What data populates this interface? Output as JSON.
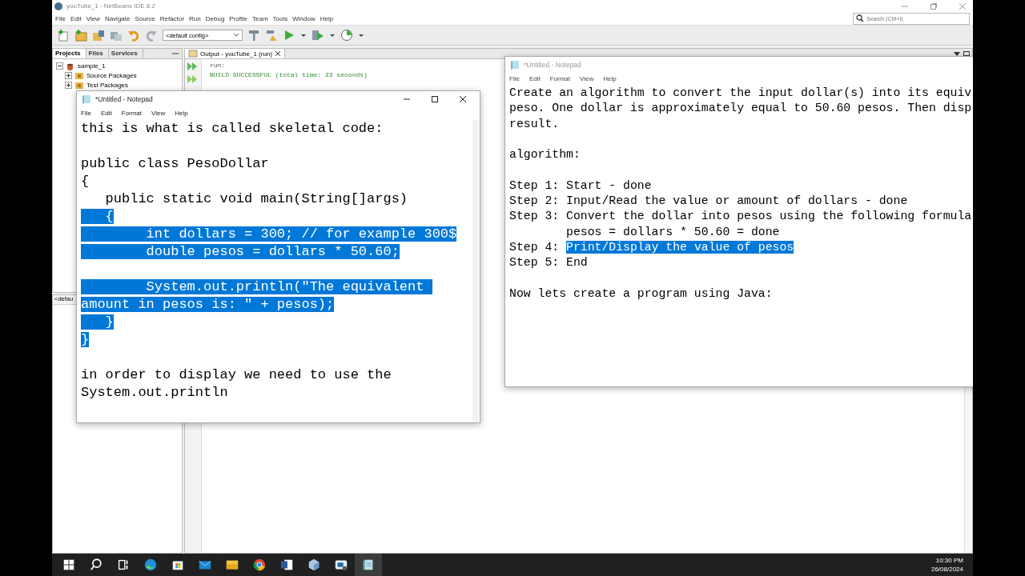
{
  "ide": {
    "title": "youTube_1 - NetBeans IDE 8.2",
    "menu": [
      "File",
      "Edit",
      "View",
      "Navigate",
      "Source",
      "Refactor",
      "Run",
      "Debug",
      "Profile",
      "Team",
      "Tools",
      "Window",
      "Help"
    ],
    "config": "<default config>",
    "search": {
      "placeholder": "Search (Ctrl+I)"
    }
  },
  "projects_panel": {
    "tabs": [
      {
        "label": "Projects",
        "selected": true
      },
      {
        "label": "Files",
        "selected": false
      },
      {
        "label": "Services",
        "selected": false
      }
    ],
    "tree": [
      {
        "label": "sample_1",
        "expanded": true,
        "children": [
          {
            "label": "Source Packages",
            "expanded": false
          },
          {
            "label": "Test Packages",
            "expanded": false
          }
        ]
      }
    ],
    "navigator_label": "<defau"
  },
  "output": {
    "tab": "Output - youTube_1 (run)",
    "lines": [
      {
        "text": "run:",
        "kind": "plain"
      },
      {
        "text": "BUILD SUCCESSFUL (total time: 23 seconds)",
        "kind": "success"
      }
    ]
  },
  "notepads": [
    {
      "title": "*Untitled - Notepad",
      "active": true,
      "menu": [
        "File",
        "Edit",
        "Format",
        "View",
        "Help"
      ],
      "blocks": [
        [
          {
            "segs": [
              {
                "text": "this is what is called skeletal code:",
                "selected": false
              }
            ]
          }
        ],
        [
          {
            "segs": [
              {
                "text": "public class PesoDollar",
                "selected": false
              }
            ]
          },
          {
            "segs": [
              {
                "text": "{",
                "selected": false
              }
            ]
          },
          {
            "segs": [
              {
                "text": "   public static void main(String[]args)",
                "selected": false
              }
            ]
          },
          {
            "segs": [
              {
                "text": "   {",
                "selected": true
              }
            ]
          },
          {
            "segs": [
              {
                "text": "        int dollars = 300; // for example 300$",
                "selected": true
              }
            ]
          },
          {
            "segs": [
              {
                "text": "        double pesos = dollars * 50.60;",
                "selected": true
              }
            ]
          }
        ],
        [
          {
            "segs": [
              {
                "text": "        System.out.println(\"The equivalent ",
                "selected": true
              }
            ]
          },
          {
            "segs": [
              {
                "text": "amount in pesos is: \" + pesos);",
                "selected": true
              }
            ]
          },
          {
            "segs": [
              {
                "text": "   }",
                "selected": true
              }
            ]
          },
          {
            "segs": [
              {
                "text": "}",
                "selected": true
              }
            ]
          }
        ],
        [
          {
            "segs": [
              {
                "text": "in order to display we need to use the",
                "selected": false
              }
            ]
          },
          {
            "segs": [
              {
                "text": "System.out.println",
                "selected": false
              }
            ]
          }
        ]
      ]
    },
    {
      "title": "*Untitled - Notepad",
      "active": false,
      "menu": [
        "File",
        "Edit",
        "Format",
        "View",
        "Help"
      ],
      "blocks": [
        [
          {
            "segs": [
              {
                "text": "Create an algorithm to convert the input dollar(s) into its equiv",
                "selected": false
              }
            ]
          },
          {
            "segs": [
              {
                "text": "peso. One dollar is approximately equal to 50.60 pesos. Then disp",
                "selected": false
              }
            ]
          },
          {
            "segs": [
              {
                "text": "result.",
                "selected": false
              }
            ]
          }
        ],
        [
          {
            "segs": [
              {
                "text": "algorithm:",
                "selected": false
              }
            ]
          }
        ],
        [
          {
            "segs": [
              {
                "text": "Step 1: Start - done",
                "selected": false
              }
            ]
          },
          {
            "segs": [
              {
                "text": "Step 2: Input/Read the value or amount of dollars - done",
                "selected": false
              }
            ]
          },
          {
            "segs": [
              {
                "text": "Step 3: Convert the dollar into pesos using the following formula",
                "selected": false
              }
            ]
          },
          {
            "segs": [
              {
                "text": "        pesos = dollars * 50.60 = done",
                "selected": false
              }
            ]
          },
          {
            "segs": [
              {
                "text": "Step 4: ",
                "selected": false
              },
              {
                "text": "Print/Display the value of pesos",
                "selected": true
              }
            ]
          },
          {
            "segs": [
              {
                "text": "Step 5: End",
                "selected": false
              }
            ]
          }
        ],
        [
          {
            "segs": [
              {
                "text": "Now lets create a program using Java:",
                "selected": false
              }
            ]
          }
        ]
      ]
    }
  ],
  "taskbar": {
    "apps": [
      {
        "kind": "start",
        "selected": false
      },
      {
        "kind": "search",
        "selected": false
      },
      {
        "kind": "taskview",
        "selected": false
      },
      {
        "kind": "edge",
        "selected": false
      },
      {
        "kind": "store",
        "selected": false
      },
      {
        "kind": "mail",
        "selected": false
      },
      {
        "kind": "explorer",
        "selected": false
      },
      {
        "kind": "chrome",
        "selected": false
      },
      {
        "kind": "word",
        "selected": false
      },
      {
        "kind": "cube",
        "selected": false
      },
      {
        "kind": "remote",
        "selected": false
      },
      {
        "kind": "notepad",
        "selected": true
      }
    ],
    "time": "10:30 PM",
    "date": "26/08/2024"
  }
}
